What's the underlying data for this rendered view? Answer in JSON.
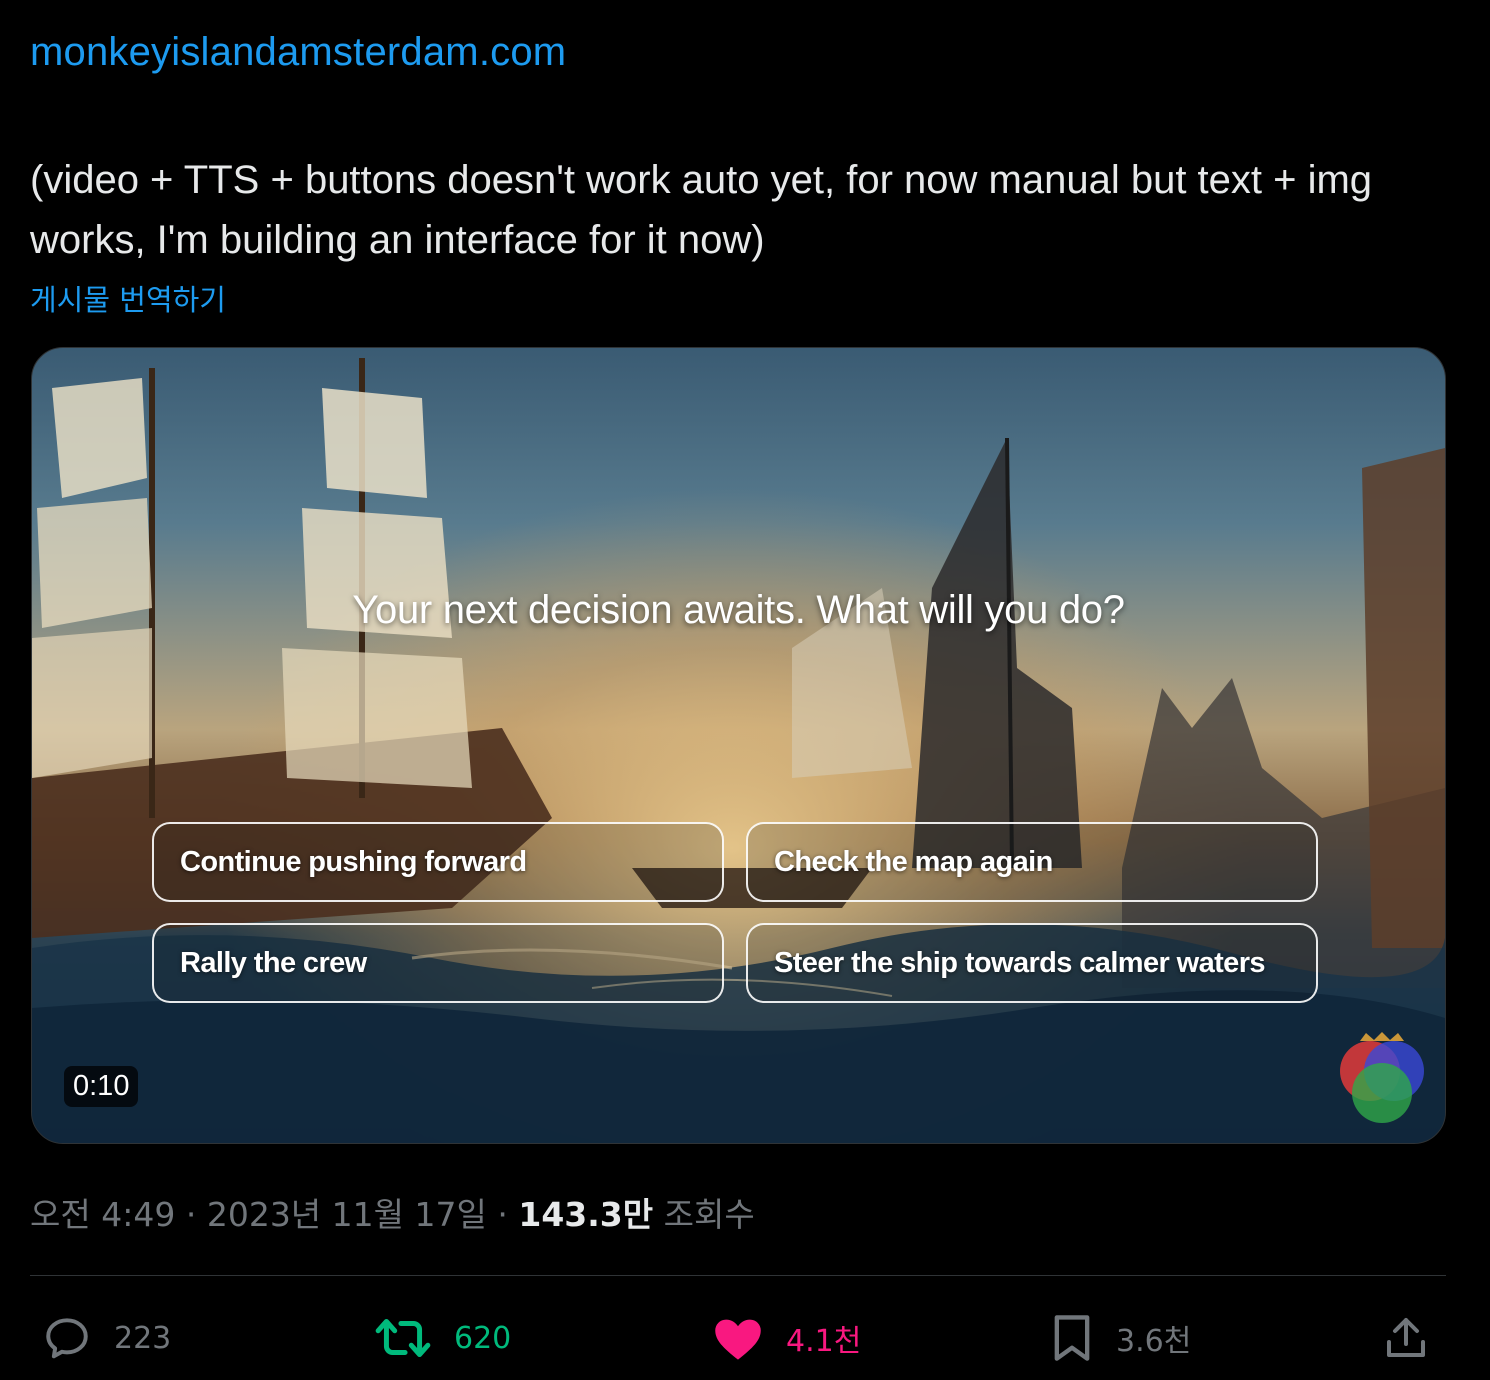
{
  "post": {
    "link_text": "monkeyislandamsterdam.com",
    "text": "(video + TTS + buttons doesn't work auto yet, for now manual but text + img works, I'm building an interface for it now)",
    "translate_label": "게시물 번역하기"
  },
  "media": {
    "question": "Your next decision awaits. What will you do?",
    "choices": [
      "Continue pushing forward",
      "Check the map again",
      "Rally the crew",
      "Steer the ship towards calmer waters"
    ],
    "timestamp": "0:10"
  },
  "meta": {
    "time": "오전 4:49",
    "separator": "·",
    "date": "2023년 11월 17일",
    "views_count": "143.3만",
    "views_label": "조회수"
  },
  "actions": {
    "replies": "223",
    "reposts": "620",
    "likes": "4.1천",
    "bookmarks": "3.6천"
  },
  "colors": {
    "accent": "#1d9bf0",
    "repost_active": "#00ba7c",
    "like_active": "#f91880",
    "muted": "#71767b"
  },
  "icons": [
    "reply-icon",
    "repost-icon",
    "like-icon",
    "bookmark-icon",
    "share-icon",
    "logo-icon"
  ]
}
